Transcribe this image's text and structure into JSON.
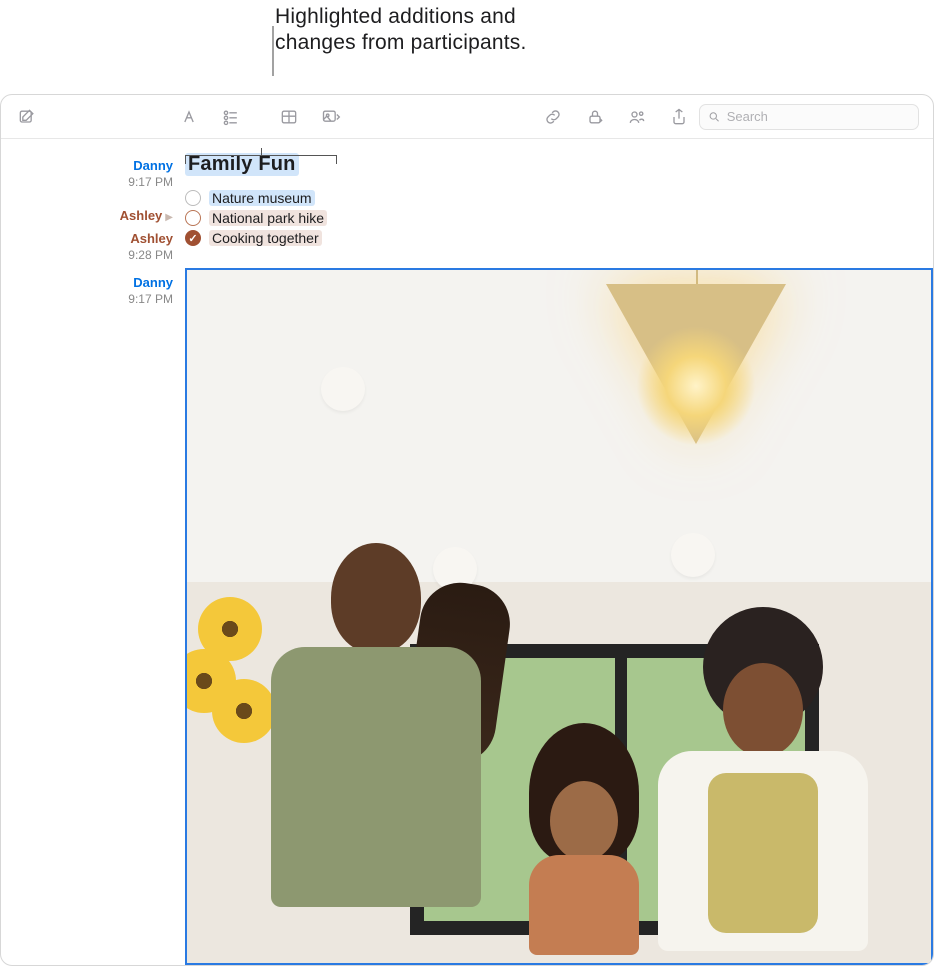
{
  "annotation": {
    "line1": "Highlighted additions and",
    "line2": "changes from participants."
  },
  "toolbar": {
    "search_placeholder": "Search"
  },
  "gutter": {
    "e1": {
      "who": "Danny",
      "time": "9:17 PM"
    },
    "e2": {
      "who": "Ashley"
    },
    "e3": {
      "who": "Ashley",
      "time": "9:28 PM"
    },
    "e4": {
      "who": "Danny",
      "time": "9:17 PM"
    }
  },
  "note": {
    "title": "Family Fun",
    "items": {
      "0": {
        "text": "Nature museum",
        "state": "unchecked",
        "author": "danny"
      },
      "1": {
        "text": "National park hike",
        "state": "unchecked",
        "author": "ashley"
      },
      "2": {
        "text": "Cooking together",
        "state": "checked",
        "author": "ashley"
      }
    }
  }
}
